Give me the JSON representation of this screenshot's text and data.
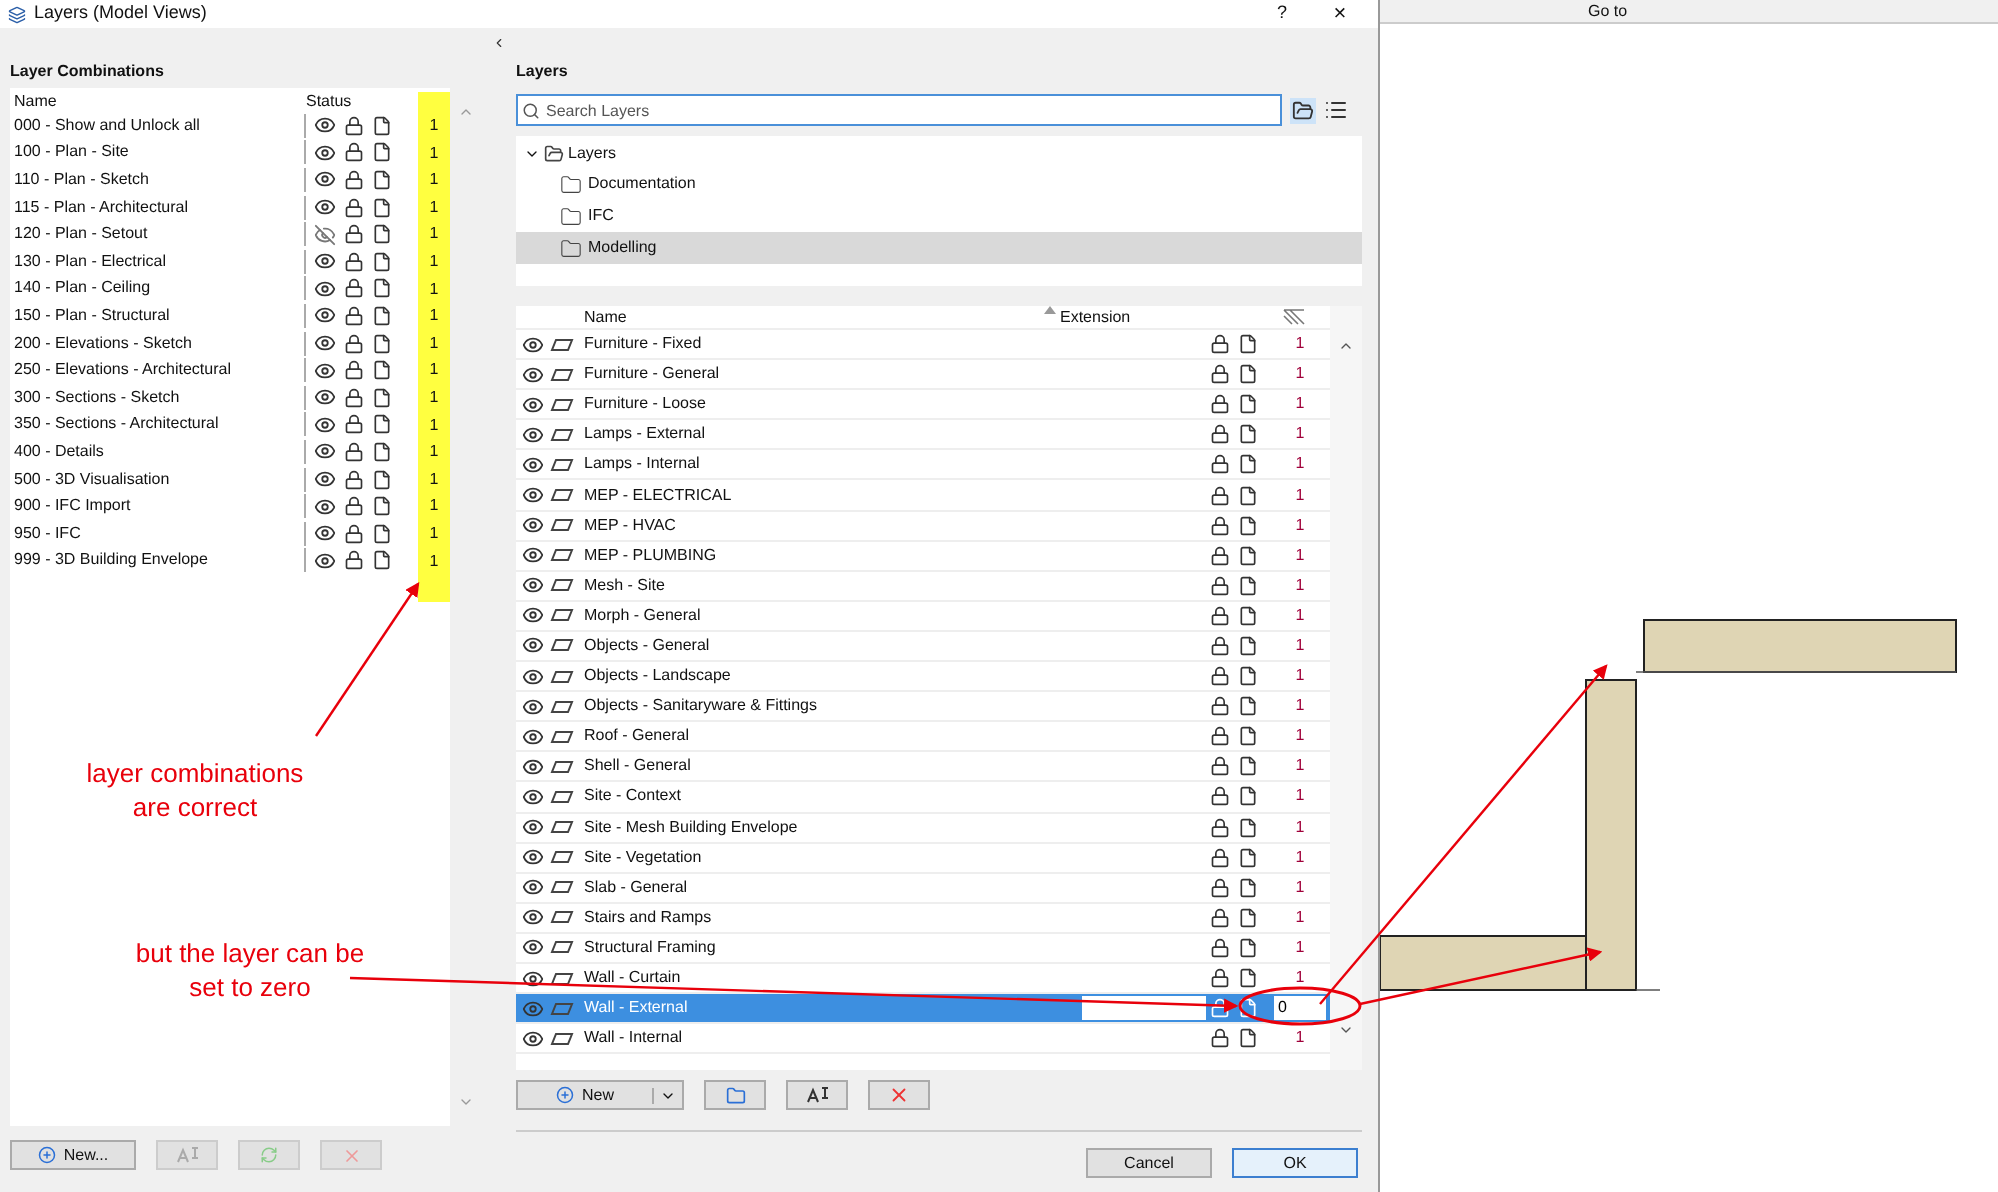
{
  "window": {
    "title": "Layers (Model Views)",
    "help": "?",
    "close": "×"
  },
  "combinations": {
    "heading": "Layer Combinations",
    "columns": [
      "Name",
      "Status"
    ],
    "rows": [
      {
        "name": "000 - Show and Unlock all",
        "visible": true,
        "value": "1"
      },
      {
        "name": "100 - Plan - Site",
        "visible": true,
        "value": "1"
      },
      {
        "name": "110 - Plan - Sketch",
        "visible": true,
        "value": "1"
      },
      {
        "name": "115 - Plan - Architectural",
        "visible": true,
        "value": "1"
      },
      {
        "name": "120 - Plan - Setout",
        "visible": false,
        "value": "1"
      },
      {
        "name": "130 - Plan - Electrical",
        "visible": true,
        "value": "1"
      },
      {
        "name": "140 - Plan - Ceiling",
        "visible": true,
        "value": "1"
      },
      {
        "name": "150 - Plan - Structural",
        "visible": true,
        "value": "1"
      },
      {
        "name": "200 - Elevations - Sketch",
        "visible": true,
        "value": "1"
      },
      {
        "name": "250 - Elevations - Architectural",
        "visible": true,
        "value": "1"
      },
      {
        "name": "300 - Sections - Sketch",
        "visible": true,
        "value": "1"
      },
      {
        "name": "350 - Sections - Architectural",
        "visible": true,
        "value": "1"
      },
      {
        "name": "400 - Details",
        "visible": true,
        "value": "1"
      },
      {
        "name": "500 - 3D Visualisation",
        "visible": true,
        "value": "1"
      },
      {
        "name": "900 - IFC Import",
        "visible": true,
        "value": "1"
      },
      {
        "name": "950 - IFC",
        "visible": true,
        "value": "1"
      },
      {
        "name": "999 - 3D Building Envelope",
        "visible": true,
        "value": "1"
      }
    ],
    "new_button": "New..."
  },
  "layers": {
    "heading": "Layers",
    "search": {
      "placeholder": "Search Layers"
    },
    "tree": {
      "label": "Layers",
      "expanded": true,
      "children": [
        {
          "label": "Documentation",
          "selected": false
        },
        {
          "label": "IFC",
          "selected": false
        },
        {
          "label": "Modelling",
          "selected": true
        }
      ]
    },
    "columns": [
      "Name",
      "Extension"
    ],
    "rows": [
      {
        "name": "Furniture - Fixed",
        "visible": true,
        "value": "1",
        "selected": false
      },
      {
        "name": "Furniture - General",
        "visible": true,
        "value": "1",
        "selected": false
      },
      {
        "name": "Furniture - Loose",
        "visible": true,
        "value": "1",
        "selected": false
      },
      {
        "name": "Lamps - External",
        "visible": true,
        "value": "1",
        "selected": false
      },
      {
        "name": "Lamps - Internal",
        "visible": true,
        "value": "1",
        "selected": false
      },
      {
        "name": "MEP - ELECTRICAL",
        "visible": true,
        "value": "1",
        "selected": false
      },
      {
        "name": "MEP - HVAC",
        "visible": true,
        "value": "1",
        "selected": false
      },
      {
        "name": "MEP - PLUMBING",
        "visible": true,
        "value": "1",
        "selected": false
      },
      {
        "name": "Mesh - Site",
        "visible": true,
        "value": "1",
        "selected": false
      },
      {
        "name": "Morph - General",
        "visible": true,
        "value": "1",
        "selected": false
      },
      {
        "name": "Objects - General",
        "visible": true,
        "value": "1",
        "selected": false
      },
      {
        "name": "Objects - Landscape",
        "visible": true,
        "value": "1",
        "selected": false
      },
      {
        "name": "Objects - Sanitaryware & Fittings",
        "visible": true,
        "value": "1",
        "selected": false
      },
      {
        "name": "Roof - General",
        "visible": true,
        "value": "1",
        "selected": false
      },
      {
        "name": "Shell - General",
        "visible": true,
        "value": "1",
        "selected": false
      },
      {
        "name": "Site - Context",
        "visible": true,
        "value": "1",
        "selected": false
      },
      {
        "name": "Site - Mesh Building Envelope",
        "visible": true,
        "value": "1",
        "selected": false
      },
      {
        "name": "Site - Vegetation",
        "visible": true,
        "value": "1",
        "selected": false
      },
      {
        "name": "Slab - General",
        "visible": true,
        "value": "1",
        "selected": false
      },
      {
        "name": "Stairs and Ramps",
        "visible": true,
        "value": "1",
        "selected": false
      },
      {
        "name": "Structural Framing",
        "visible": true,
        "value": "1",
        "selected": false
      },
      {
        "name": "Wall - Curtain",
        "visible": true,
        "value": "1",
        "selected": false
      },
      {
        "name": "Wall - External",
        "visible": true,
        "value": "0",
        "selected": true
      },
      {
        "name": "Wall - Internal",
        "visible": true,
        "value": "1",
        "selected": false
      }
    ],
    "new_button": "New",
    "cancel": "Cancel",
    "ok": "OK"
  },
  "toolbar": {
    "goto": "Go to"
  },
  "annotations": [
    {
      "text": "layer combinations are correct"
    },
    {
      "text": "but the layer can be set to zero"
    }
  ]
}
